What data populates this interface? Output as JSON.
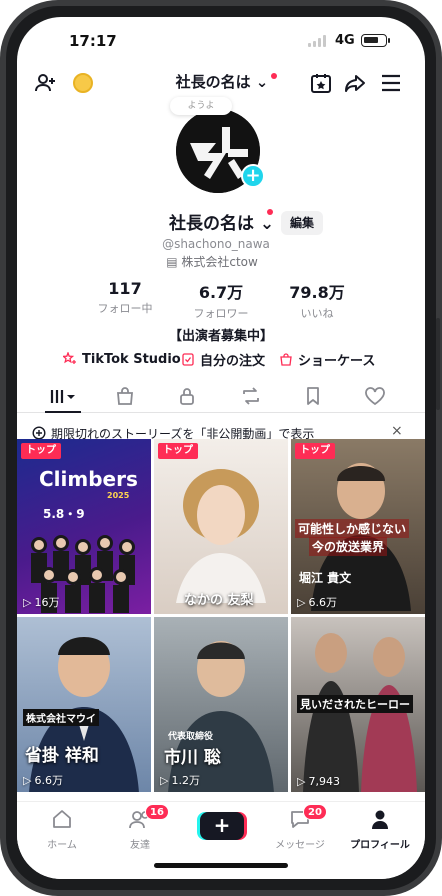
{
  "status_bar": {
    "time": "17:17",
    "network": "4G",
    "battery_level": 0.75
  },
  "header": {
    "title": "社長の名は",
    "title_arrow": "⌄"
  },
  "avatar": {
    "bubble_text": "ようよ"
  },
  "profile": {
    "display_name": "社長の名は",
    "edit_label": "編集",
    "username": "@shachono_nawa",
    "company": "株式会社ctow"
  },
  "stats": [
    {
      "value": "117",
      "label": "フォロー中"
    },
    {
      "value": "6.7万",
      "label": "フォロワー"
    },
    {
      "value": "79.8万",
      "label": "いいね"
    }
  ],
  "bio": "【出演者募集中】",
  "links": {
    "studio": "TikTok Studio",
    "orders": "自分の注文",
    "showcase": "ショーケース"
  },
  "story_banner": {
    "text": "期限切れのストーリーズを「非公開動画」で表示",
    "close": "×"
  },
  "videos": [
    {
      "badge": "トップ",
      "views": "16万",
      "caption": "Climbers",
      "sub": "2025",
      "date": "5.8・9",
      "colors": [
        "#1c2b8f",
        "#7b1fa2"
      ]
    },
    {
      "badge": "トップ",
      "views": "",
      "caption": "なかの 友梨",
      "sub": "",
      "date": "",
      "colors": [
        "#efe8e2",
        "#c9b9ad"
      ]
    },
    {
      "badge": "トップ",
      "views": "6.6万",
      "caption": "可能性しか感じない",
      "sub": "今の放送業界",
      "date": "堀江 貴文",
      "colors": [
        "#6b5a4a",
        "#2a2520"
      ]
    },
    {
      "badge": "",
      "views": "6.6万",
      "caption": "省掛 祥和",
      "sub": "株式会社マウイ",
      "date": "",
      "colors": [
        "#7a93b5",
        "#1d2c4a"
      ]
    },
    {
      "badge": "",
      "views": "1.2万",
      "caption": "市川 聡",
      "sub": "代表取締役",
      "date": "",
      "colors": [
        "#9aa3a9",
        "#3b4349"
      ]
    },
    {
      "badge": "",
      "views": "7,943",
      "caption": "見いだされたヒーロー",
      "sub": "",
      "date": "",
      "colors": [
        "#b9b3ae",
        "#4e4a47"
      ]
    }
  ],
  "bottom_nav": {
    "home": "ホーム",
    "friends": "友達",
    "friends_badge": "16",
    "create": "+",
    "inbox": "メッセージ",
    "inbox_badge": "20",
    "profile": "プロフィール"
  },
  "colors": {
    "accent": "#fe2c55",
    "cyan": "#25f4ee",
    "text": "#161823",
    "muted": "#8a8b91"
  },
  "icons": [
    "add-friend-icon",
    "coin-icon",
    "chevron-down-icon",
    "calendar-star-icon",
    "share-icon",
    "menu-icon",
    "grid-icon",
    "bag-icon",
    "lock-icon",
    "repost-icon",
    "bookmark-icon",
    "heart-icon",
    "story-icon",
    "play-icon",
    "home-icon",
    "friends-icon",
    "inbox-icon",
    "profile-icon"
  ]
}
